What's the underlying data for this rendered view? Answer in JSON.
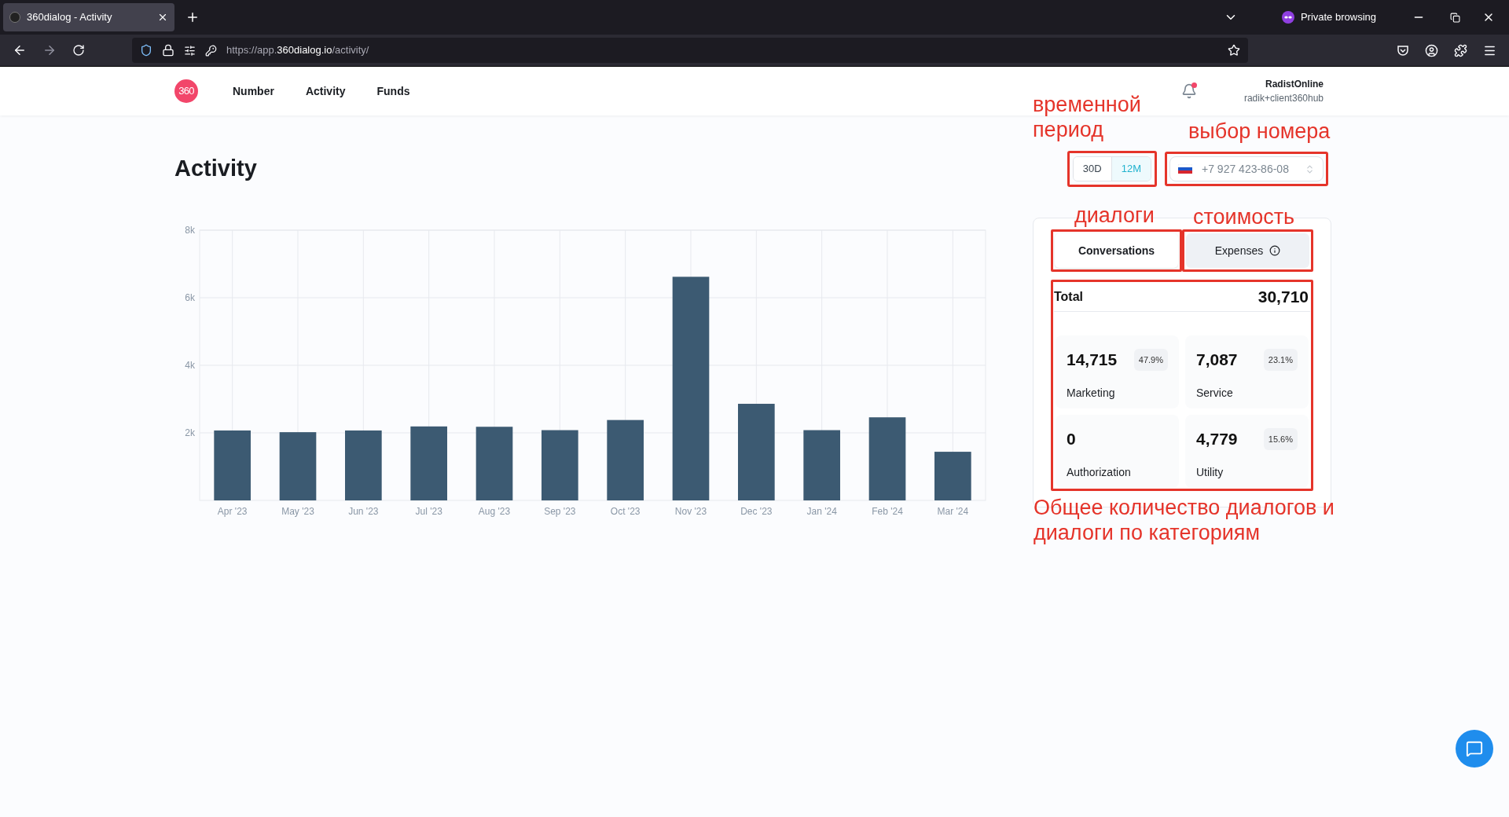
{
  "browser": {
    "tab_title": "360dialog - Activity",
    "url_prefix": "https://app.",
    "url_domain": "360dialog.io",
    "url_path": "/activity/",
    "private_label": "Private browsing"
  },
  "nav": {
    "logo": "360",
    "items": [
      "Number",
      "Activity",
      "Funds"
    ]
  },
  "user": {
    "name": "RadistOnline",
    "email": "radik+client360hub",
    "notification": true
  },
  "page_title": "Activity",
  "period_options": [
    {
      "label": "30D",
      "selected": false
    },
    {
      "label": "12M",
      "selected": true
    }
  ],
  "phone_select": {
    "value": "+7 927 423-86-08"
  },
  "chart_data": {
    "type": "bar",
    "categories": [
      "Apr '23",
      "May '23",
      "Jun '23",
      "Jul '23",
      "Aug '23",
      "Sep '23",
      "Oct '23",
      "Nov '23",
      "Dec '23",
      "Jan '24",
      "Feb '24",
      "Mar '24"
    ],
    "series": [
      {
        "color": "#3c5a72",
        "values": [
          2070,
          2020,
          2070,
          2190,
          2180,
          2080,
          2380,
          6620,
          2860,
          2080,
          2460,
          1440
        ]
      }
    ],
    "grid": true,
    "ylim": [
      0,
      8000
    ],
    "yticks": [
      {
        "value": 2000,
        "label": "2k"
      },
      {
        "value": 4000,
        "label": "4k"
      },
      {
        "value": 6000,
        "label": "6k"
      },
      {
        "value": 8000,
        "label": "8k"
      }
    ]
  },
  "tabs": [
    {
      "label": "Conversations",
      "selected": true,
      "info": false
    },
    {
      "label": "Expenses",
      "selected": false,
      "info": true
    }
  ],
  "total": {
    "label": "Total",
    "value": "30,710"
  },
  "categories": [
    {
      "value": "14,715",
      "share": "47.9%",
      "label": "Marketing"
    },
    {
      "value": "7,087",
      "share": "23.1%",
      "label": "Service"
    },
    {
      "value": "0",
      "label": "Authorization"
    },
    {
      "value": "4,779",
      "share": "15.6%",
      "label": "Utility"
    }
  ],
  "annotations": {
    "period": "временной период",
    "number": "выбор номера",
    "conversations": "диалоги",
    "expenses": "стоимость",
    "summary": "Общее количество диалогов и диалоги по категориям"
  }
}
